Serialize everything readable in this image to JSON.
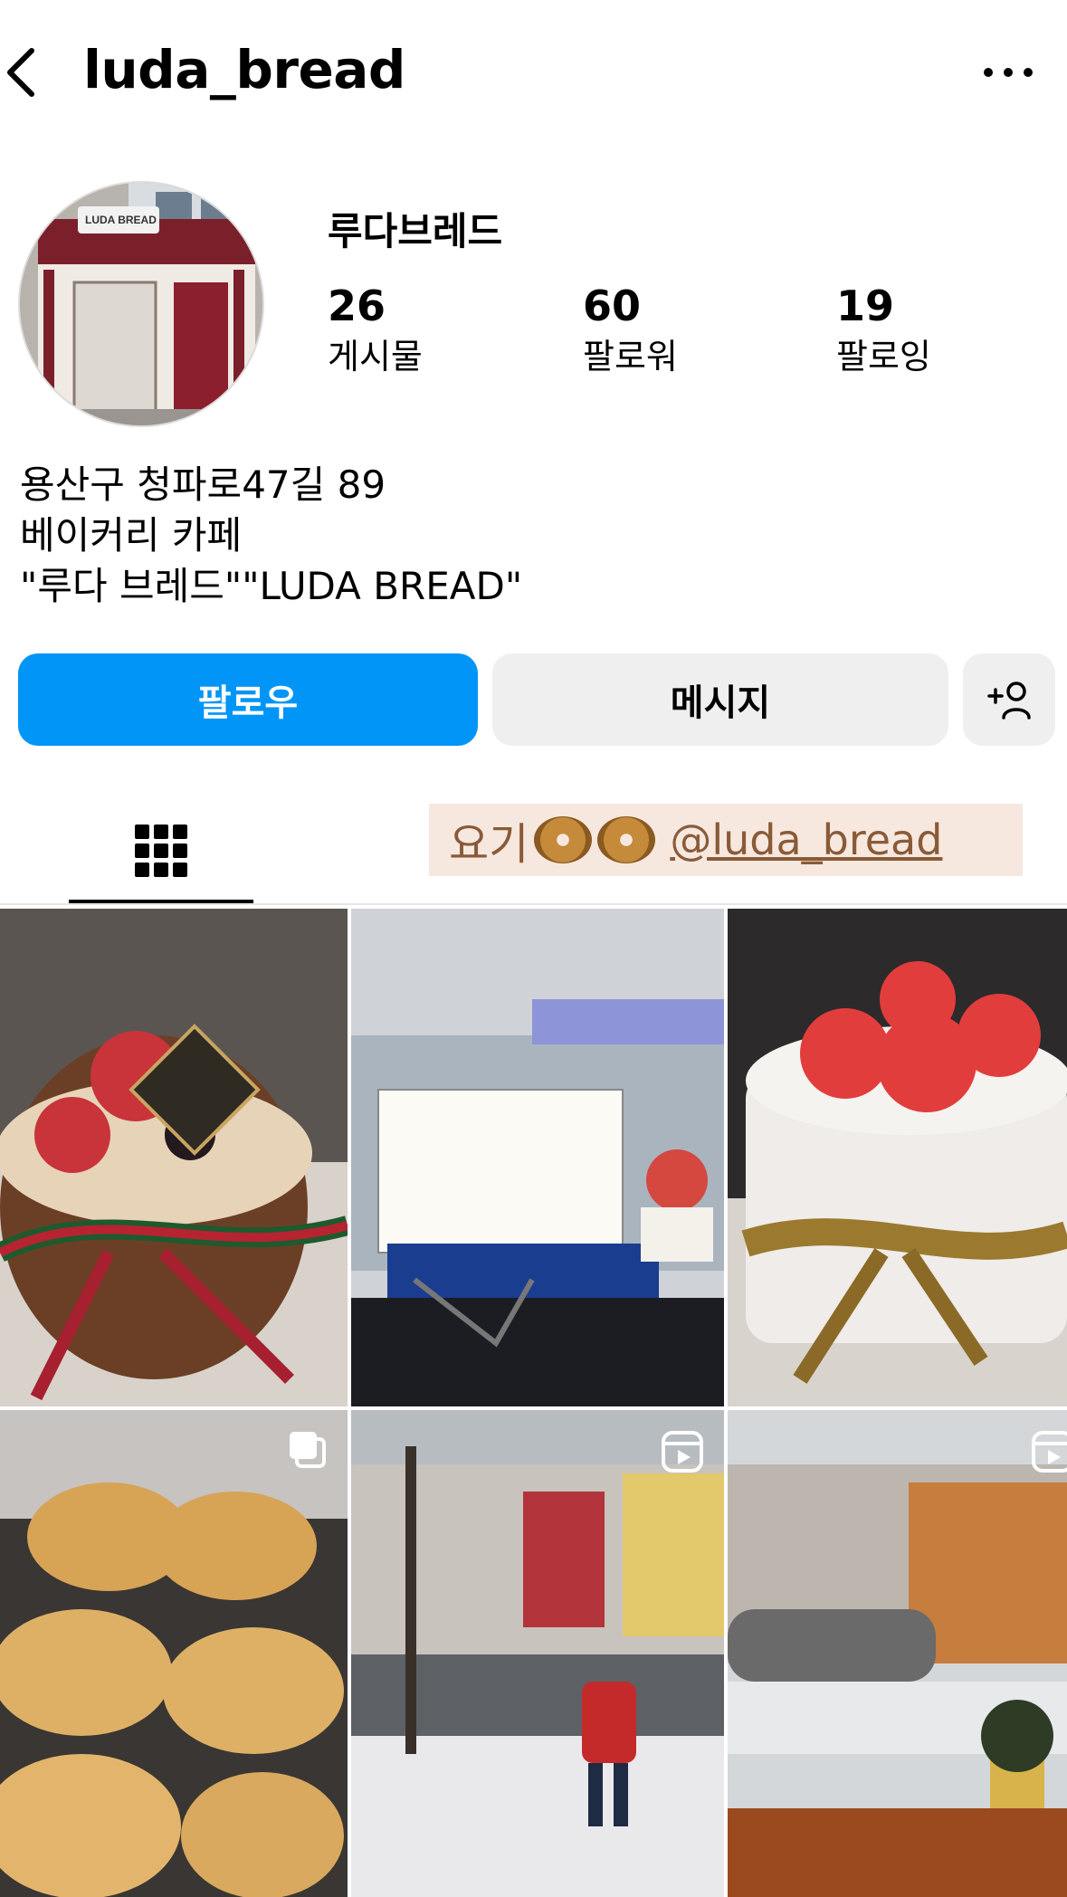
{
  "header": {
    "username": "luda_bread"
  },
  "profile": {
    "display_name": "루다브레드",
    "stats": [
      {
        "value": "26",
        "label": "게시물"
      },
      {
        "value": "60",
        "label": "팔로워"
      },
      {
        "value": "19",
        "label": "팔로잉"
      }
    ],
    "bio": [
      "용산구 청파로47길 89",
      "베이커리 카페",
      "\"루다 브레드\"\"LUDA BREAD\""
    ],
    "avatar_sign": "LUDA BREAD"
  },
  "buttons": {
    "follow": "팔로우",
    "message": "메시지"
  },
  "highlight": {
    "prefix": "요기",
    "handle": "@luda_bread"
  },
  "posts": [
    {
      "caption": "strawberry chocolate cake"
    },
    {
      "caption": "happy birthday cake sign"
    },
    {
      "caption": "strawberry cream cake"
    },
    {
      "caption": "meringue cookies in cups"
    },
    {
      "caption": "snowy street video"
    },
    {
      "caption": "snowy street from cafe window"
    }
  ],
  "colors": {
    "follow_blue": "#0095f6",
    "button_grey": "#efefef",
    "highlight_bg": "#f6e8df",
    "highlight_text": "#8a5a37"
  }
}
